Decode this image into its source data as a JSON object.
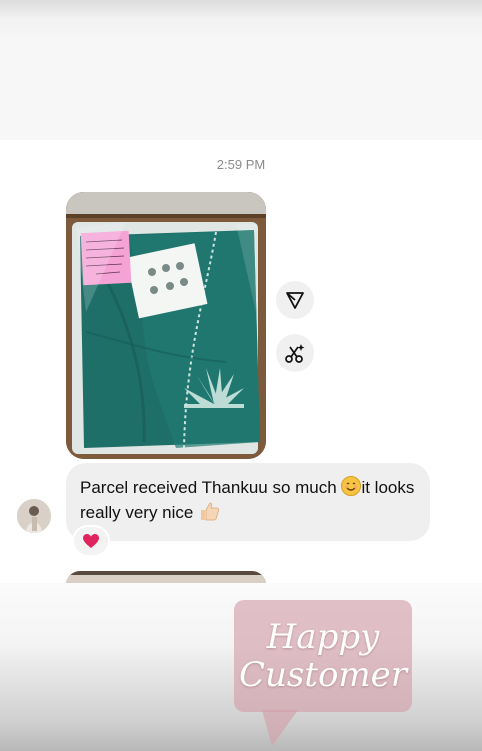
{
  "chat": {
    "timestamp": "2:59 PM",
    "message_text_part1": "Parcel received Thankuu so much ",
    "message_text_part2": "it looks really very nice ",
    "emoji_smile": "smiling-face-emoji",
    "emoji_thumb": "thumbs-up-emoji",
    "reaction": "red-heart",
    "note_lines": [
      "Dear Mahfuza Ben,",
      "Thank you for order",
      "hope you love your outfit",
      "receive & feel more",
      "Thank U ♡"
    ]
  },
  "actions": {
    "share_icon": "share-icon",
    "ai_icon": "ai-sparkle-scissors-icon"
  },
  "sticker": {
    "line1": "Happy",
    "line2": "Customer"
  },
  "colors": {
    "bubble": "#efefef",
    "parcel_green": "#1e6b66",
    "sticker": "#d2a0aa",
    "heart": "#e0245e"
  }
}
